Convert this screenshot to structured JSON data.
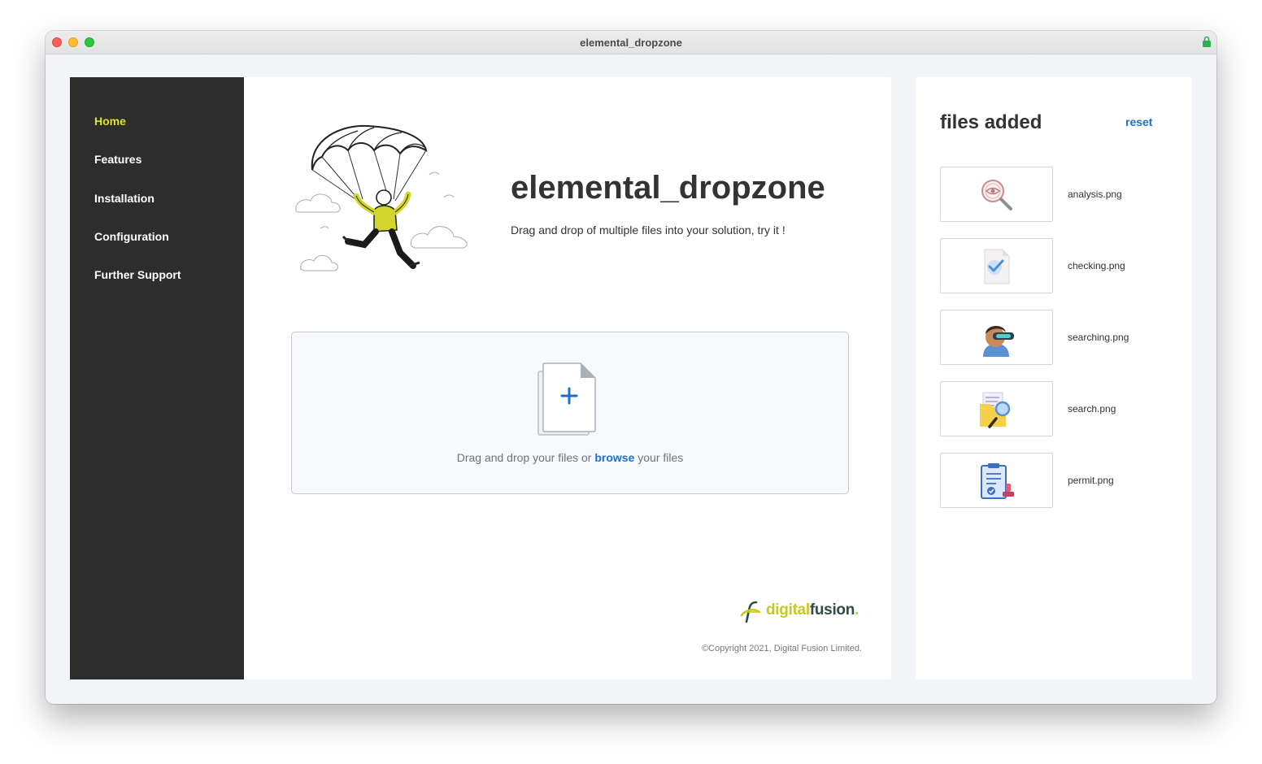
{
  "window": {
    "title": "elemental_dropzone"
  },
  "sidebar": {
    "items": [
      {
        "label": "Home",
        "active": true
      },
      {
        "label": "Features"
      },
      {
        "label": "Installation"
      },
      {
        "label": "Configuration"
      },
      {
        "label": "Further Support"
      }
    ]
  },
  "hero": {
    "title": "elemental_dropzone",
    "subtitle": "Drag and drop of multiple files into your solution, try it !"
  },
  "dropzone": {
    "text_before": "Drag and drop your files or ",
    "link": "browse",
    "text_after": " your files"
  },
  "footer": {
    "logo_part1": "digital",
    "logo_part2": "fusion",
    "logo_dot": ".",
    "copyright": "©Copyright 2021, Digital Fusion Limited."
  },
  "files_panel": {
    "title": "files added",
    "reset_label": "reset",
    "files": [
      {
        "name": "analysis.png",
        "icon": "magnifier-eye-icon"
      },
      {
        "name": "checking.png",
        "icon": "document-check-icon"
      },
      {
        "name": "searching.png",
        "icon": "vr-headset-person-icon"
      },
      {
        "name": "search.png",
        "icon": "folder-search-icon"
      },
      {
        "name": "permit.png",
        "icon": "clipboard-stamp-icon"
      }
    ]
  },
  "colors": {
    "sidebar_bg": "#2d2d2d",
    "active_nav": "#dfe22a",
    "link_blue": "#1a6fd8",
    "accent_yellow": "#c8c81e"
  }
}
